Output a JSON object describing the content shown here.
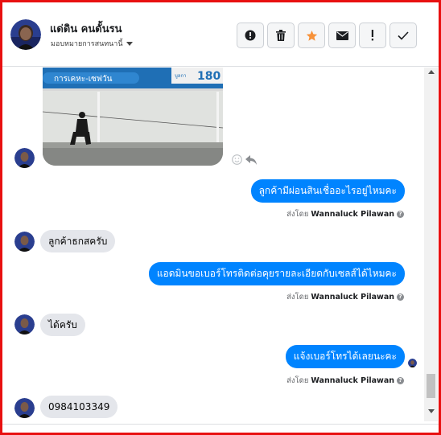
{
  "header": {
    "contact_name": "แด่ดิน คนดั้นรน",
    "assign_label": "มอบหมายการสนทนานี้",
    "actions": [
      {
        "name": "report-button",
        "icon": "alert-circle-icon"
      },
      {
        "name": "delete-button",
        "icon": "trash-icon"
      },
      {
        "name": "star-button",
        "icon": "star-icon"
      },
      {
        "name": "unread-button",
        "icon": "envelope-icon"
      },
      {
        "name": "spam-button",
        "icon": "exclamation-icon"
      },
      {
        "name": "done-button",
        "icon": "check-icon"
      }
    ],
    "star_color": "#f7923a"
  },
  "photo": {
    "sign_text": "การเคหะ-เซฟวัน",
    "sign_number": "180",
    "sign_prefix": "บูลกา"
  },
  "messages": [
    {
      "id": "m1",
      "direction": "out",
      "text": "ลูกค้ามีผ่อนสินเชื่ออะไรอยู่ไหมคะ"
    },
    {
      "id": "m2",
      "direction": "in",
      "text": "ลูกค้าธกสครับ"
    },
    {
      "id": "m3",
      "direction": "out",
      "text": "แอดมินขอเบอร์โทรติดต่อคุยรายละเอียดกับเซลส์ได้ไหมคะ"
    },
    {
      "id": "m4",
      "direction": "in",
      "text": "ได้ครับ"
    },
    {
      "id": "m5",
      "direction": "out",
      "text": "แจ้งเบอร์โทรได้เลยนะคะ"
    },
    {
      "id": "m6",
      "direction": "in",
      "text": "0984103349"
    }
  ],
  "sent_by": {
    "prefix": "ส่งโดย",
    "agent": "Wannaluck Pilawan",
    "help_glyph": "?"
  },
  "colors": {
    "outgoing": "#0084ff",
    "incoming": "#e4e6eb",
    "frame": "#e81010"
  }
}
